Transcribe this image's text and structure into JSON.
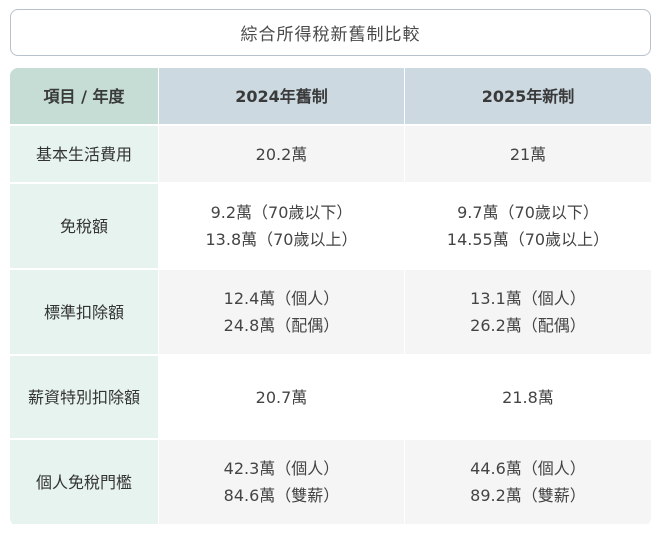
{
  "title": "綜合所得稅新舊制比較",
  "headers": [
    "項目 / 年度",
    "2024年舊制",
    "2025年新制"
  ],
  "rows": [
    {
      "label": "基本生活費用",
      "old": [
        "20.2萬"
      ],
      "new": [
        "21萬"
      ]
    },
    {
      "label": "免稅額",
      "old": [
        "9.2萬（70歲以下）",
        "13.8萬（70歲以上）"
      ],
      "new": [
        "9.7萬（70歲以下）",
        "14.55萬（70歲以上）"
      ]
    },
    {
      "label": "標準扣除額",
      "old": [
        "12.4萬（個人）",
        "24.8萬（配偶）"
      ],
      "new": [
        "13.1萬（個人）",
        "26.2萬（配偶）"
      ]
    },
    {
      "label": "薪資特別扣除額",
      "old": [
        "20.7萬"
      ],
      "new": [
        "21.8萬"
      ]
    },
    {
      "label": "個人免稅門檻",
      "old": [
        "42.3萬（個人）",
        "84.6萬（雙薪）"
      ],
      "new": [
        "44.6萬（個人）",
        "89.2萬（雙薪）"
      ]
    }
  ]
}
